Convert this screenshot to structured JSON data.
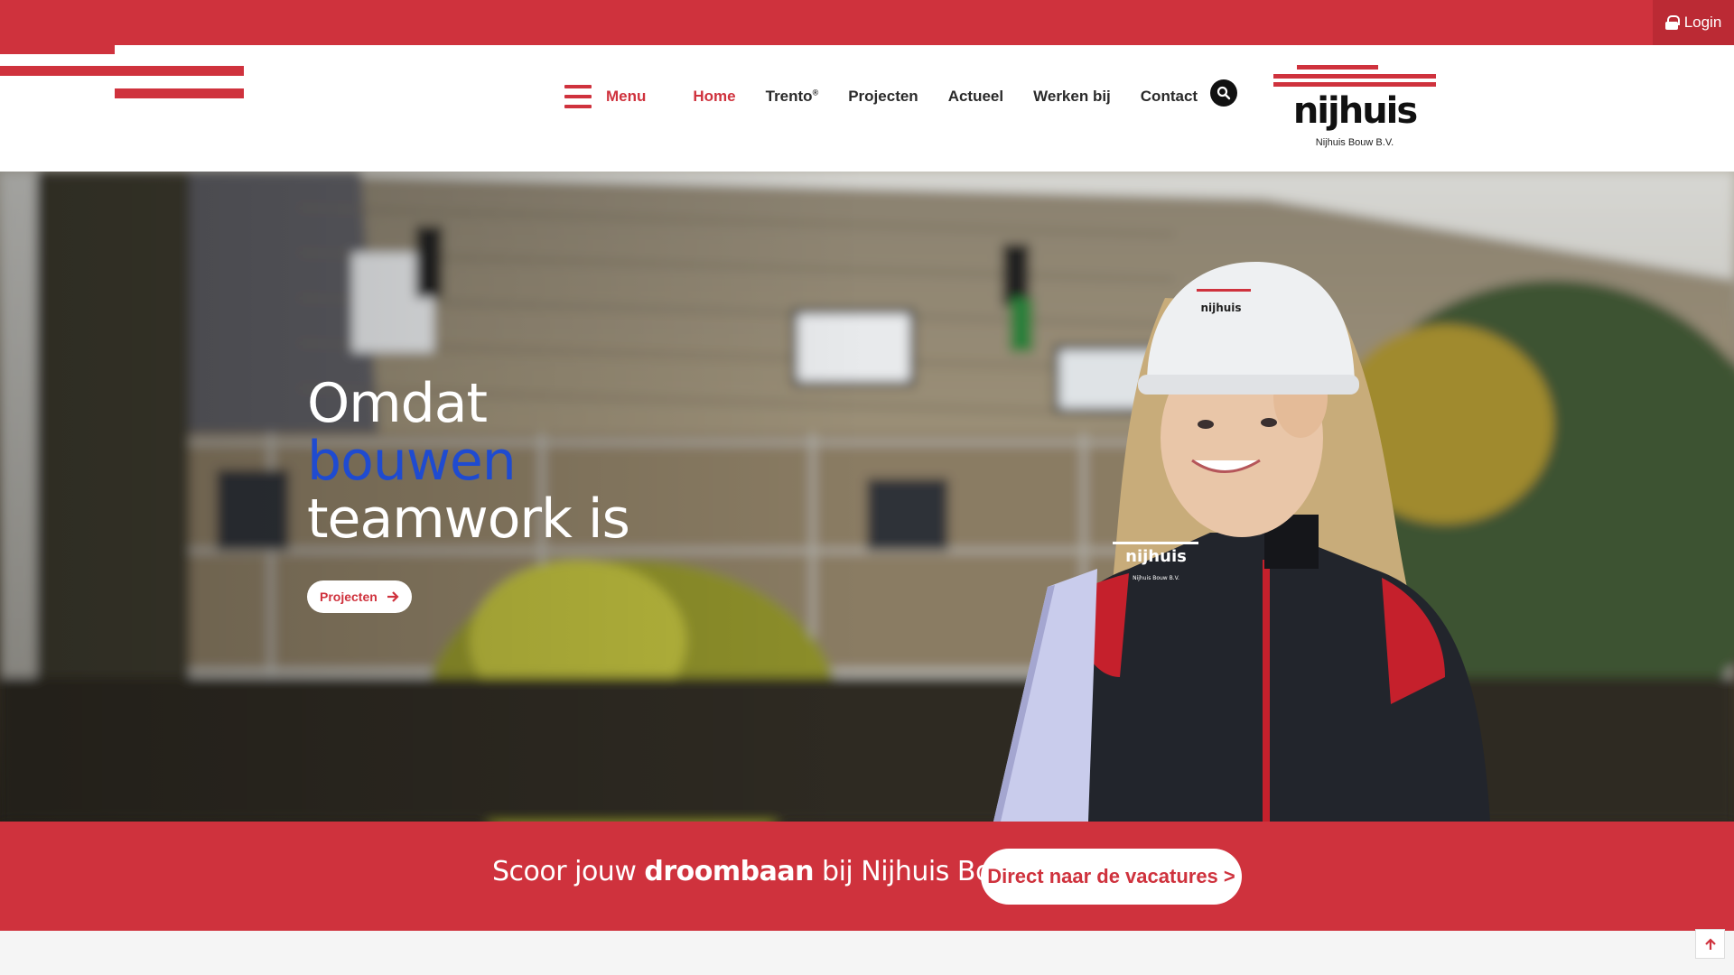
{
  "topbar": {
    "login_label": "Login",
    "icon": "lock-icon"
  },
  "header": {
    "menu_label": "Menu",
    "nav": [
      {
        "label": "Home",
        "active": true
      },
      {
        "label": "Trento",
        "sup": "®"
      },
      {
        "label": "Projecten"
      },
      {
        "label": "Actueel"
      },
      {
        "label": "Werken bij"
      },
      {
        "label": "Contact"
      }
    ],
    "search_icon": "search-icon",
    "logo_text": "nijhuis",
    "logo_caption": "Nijhuis Bouw B.V."
  },
  "hero": {
    "line1": "Omdat",
    "line2": "bouwen",
    "line3": "teamwork is",
    "button_label": "Projecten",
    "helmet_text": "nijhuis",
    "jacket_text": "nijhuis",
    "jacket_subtext": "Nijhuis Bouw B.V."
  },
  "cta": {
    "text_before": "Scoor jouw ",
    "text_bold": "droombaan",
    "text_after": " bij Nijhuis Bouw!",
    "button_label": "Direct naar de vacatures >"
  },
  "scroll_top_icon": "arrow-up-icon",
  "colors": {
    "brand_red": "#cf323d",
    "highlight_blue": "#1f4bd0"
  }
}
